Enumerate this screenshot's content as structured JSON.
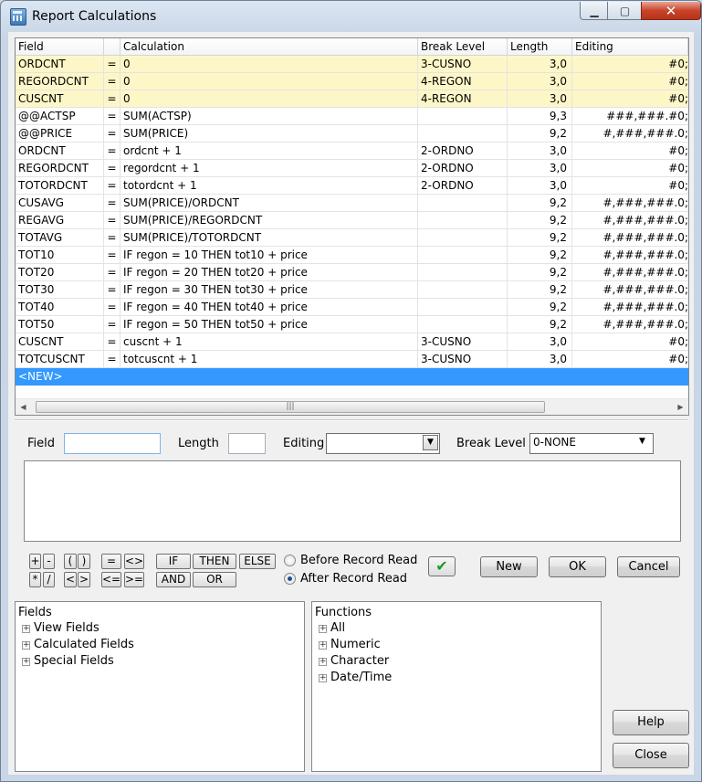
{
  "window": {
    "title": "Report Calculations"
  },
  "grid": {
    "columns": [
      "Field",
      "",
      "Calculation",
      "Break Level",
      "Length",
      "Editing"
    ],
    "rows": [
      {
        "field": "ORDCNT",
        "eq": "=",
        "calc": "0",
        "break": "3-CUSNO",
        "length": "3,0",
        "edit": "#0;",
        "hl": true
      },
      {
        "field": "REGORDCNT",
        "eq": "=",
        "calc": "0",
        "break": "4-REGON",
        "length": "3,0",
        "edit": "#0;",
        "hl": true
      },
      {
        "field": "CUSCNT",
        "eq": "=",
        "calc": "0",
        "break": "4-REGON",
        "length": "3,0",
        "edit": "#0;",
        "hl": true
      },
      {
        "field": "@@ACTSP",
        "eq": "=",
        "calc": "SUM(ACTSP)",
        "break": "",
        "length": "9,3",
        "edit": "###,###.#0;"
      },
      {
        "field": "@@PRICE",
        "eq": "=",
        "calc": "SUM(PRICE)",
        "break": "",
        "length": "9,2",
        "edit": "#,###,###.0;"
      },
      {
        "field": "ORDCNT",
        "eq": "=",
        "calc": "ordcnt + 1",
        "break": "2-ORDNO",
        "length": "3,0",
        "edit": "#0;"
      },
      {
        "field": "REGORDCNT",
        "eq": "=",
        "calc": "regordcnt + 1",
        "break": "2-ORDNO",
        "length": "3,0",
        "edit": "#0;"
      },
      {
        "field": "TOTORDCNT",
        "eq": "=",
        "calc": "totordcnt + 1",
        "break": "2-ORDNO",
        "length": "3,0",
        "edit": "#0;"
      },
      {
        "field": "CUSAVG",
        "eq": "=",
        "calc": "SUM(PRICE)/ORDCNT",
        "break": "",
        "length": "9,2",
        "edit": "#,###,###.0;"
      },
      {
        "field": "REGAVG",
        "eq": "=",
        "calc": "SUM(PRICE)/REGORDCNT",
        "break": "",
        "length": "9,2",
        "edit": "#,###,###.0;"
      },
      {
        "field": "TOTAVG",
        "eq": "=",
        "calc": "SUM(PRICE)/TOTORDCNT",
        "break": "",
        "length": "9,2",
        "edit": "#,###,###.0;"
      },
      {
        "field": "TOT10",
        "eq": "=",
        "calc": "IF regon = 10 THEN tot10 + price",
        "break": "",
        "length": "9,2",
        "edit": "#,###,###.0;"
      },
      {
        "field": "TOT20",
        "eq": "=",
        "calc": "IF regon = 20 THEN tot20 + price",
        "break": "",
        "length": "9,2",
        "edit": "#,###,###.0;"
      },
      {
        "field": "TOT30",
        "eq": "=",
        "calc": "IF regon = 30 THEN tot30 + price",
        "break": "",
        "length": "9,2",
        "edit": "#,###,###.0;"
      },
      {
        "field": "TOT40",
        "eq": "=",
        "calc": "IF regon = 40 THEN tot40 + price",
        "break": "",
        "length": "9,2",
        "edit": "#,###,###.0;"
      },
      {
        "field": "TOT50",
        "eq": "=",
        "calc": "IF regon = 50 THEN tot50 + price",
        "break": "",
        "length": "9,2",
        "edit": "#,###,###.0;"
      },
      {
        "field": "CUSCNT",
        "eq": "=",
        "calc": "cuscnt + 1",
        "break": "3-CUSNO",
        "length": "3,0",
        "edit": "#0;"
      },
      {
        "field": "TOTCUSCNT",
        "eq": "=",
        "calc": "totcuscnt + 1",
        "break": "3-CUSNO",
        "length": "3,0",
        "edit": "#0;"
      }
    ],
    "new_row_label": "<NEW>"
  },
  "scroll": {
    "left_arrow": "◀",
    "right_arrow": "▶",
    "grip": "|||"
  },
  "editor": {
    "field_label": "Field",
    "field_value": "",
    "length_label": "Length",
    "length_value": "",
    "editing_label": "Editing",
    "editing_value": "",
    "break_label": "Break Level",
    "break_value": "0-NONE"
  },
  "operators": {
    "plus": "+",
    "minus": "-",
    "lparen": "(",
    "rparen": ")",
    "eq": "=",
    "ne": "<>",
    "mult": "*",
    "div": "/",
    "lt": "<",
    "gt": ">",
    "le": "<=",
    "ge": ">=",
    "if": "IF",
    "then": "THEN",
    "else": "ELSE",
    "and": "AND",
    "or": "OR"
  },
  "timing": {
    "before": "Before Record Read",
    "after": "After Record Read",
    "selected": "after"
  },
  "buttons": {
    "new": "New",
    "ok": "OK",
    "cancel": "Cancel",
    "help": "Help",
    "close": "Close"
  },
  "fields_panel": {
    "title": "Fields",
    "items": [
      "View Fields",
      "Calculated Fields",
      "Special Fields"
    ]
  },
  "functions_panel": {
    "title": "Functions",
    "items": [
      "All",
      "Numeric",
      "Character",
      "Date/Time"
    ]
  },
  "icons": {
    "window": "calculator-icon",
    "accept": "checkmark-icon"
  },
  "colors": {
    "highlight_row": "#fdf7c8",
    "selection": "#3399ff",
    "close_button": "#c8442a"
  }
}
